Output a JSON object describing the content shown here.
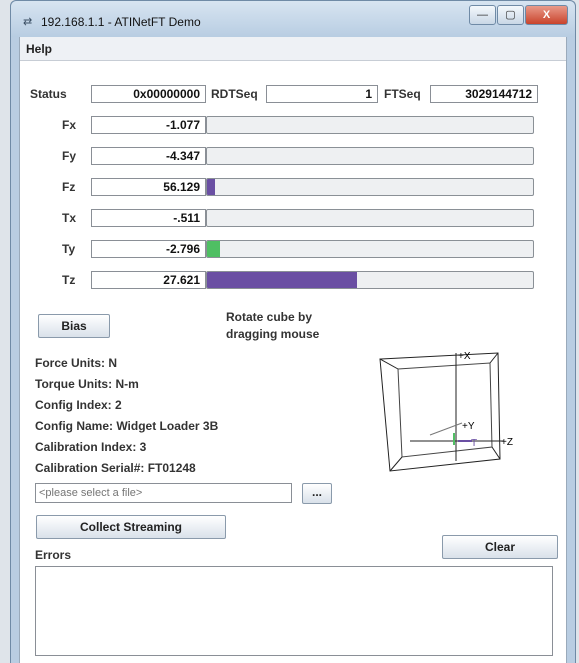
{
  "window": {
    "title": "192.168.1.1 - ATINetFT Demo",
    "app_icon": "network-icon",
    "minimize_glyph": "—",
    "maximize_glyph": "▢",
    "close_glyph": "X"
  },
  "menu": {
    "help": "Help"
  },
  "status_row": {
    "status_label": "Status",
    "status_value": "0x00000000",
    "rdtseq_label": "RDTSeq",
    "rdtseq_value": "1",
    "ftseq_label": "FTSeq",
    "ftseq_value": "3029144712"
  },
  "axes": [
    {
      "label": "Fx",
      "value": "-1.077",
      "level": 0,
      "color": ""
    },
    {
      "label": "Fy",
      "value": "-4.347",
      "level": 0,
      "color": ""
    },
    {
      "label": "Fz",
      "value": "56.129",
      "level": 0.025,
      "color": "#6a4fa3"
    },
    {
      "label": "Tx",
      "value": "-.511",
      "level": 0,
      "color": ""
    },
    {
      "label": "Ty",
      "value": "-2.796",
      "level": 0.04,
      "color": "#4fbf63"
    },
    {
      "label": "Tz",
      "value": "27.621",
      "level": 0.46,
      "color": "#6a4fa3"
    }
  ],
  "bias_button": "Bias",
  "rotate_hint": {
    "line1": "Rotate cube by",
    "line2": "dragging mouse"
  },
  "info": [
    "Force Units: N",
    "Torque Units: N-m",
    "Config Index: 2",
    "Config Name: Widget Loader 3B",
    "Calibration Index: 3",
    "Calibration Serial#: FT01248"
  ],
  "file": {
    "placeholder": "<please select a file>",
    "browse_label": "..."
  },
  "collect_button": "Collect Streaming",
  "errors_label": "Errors",
  "clear_button": "Clear",
  "cube_labels": {
    "x": "+X",
    "y": "+Y",
    "z": "+Z",
    "torque_marker": "T"
  }
}
